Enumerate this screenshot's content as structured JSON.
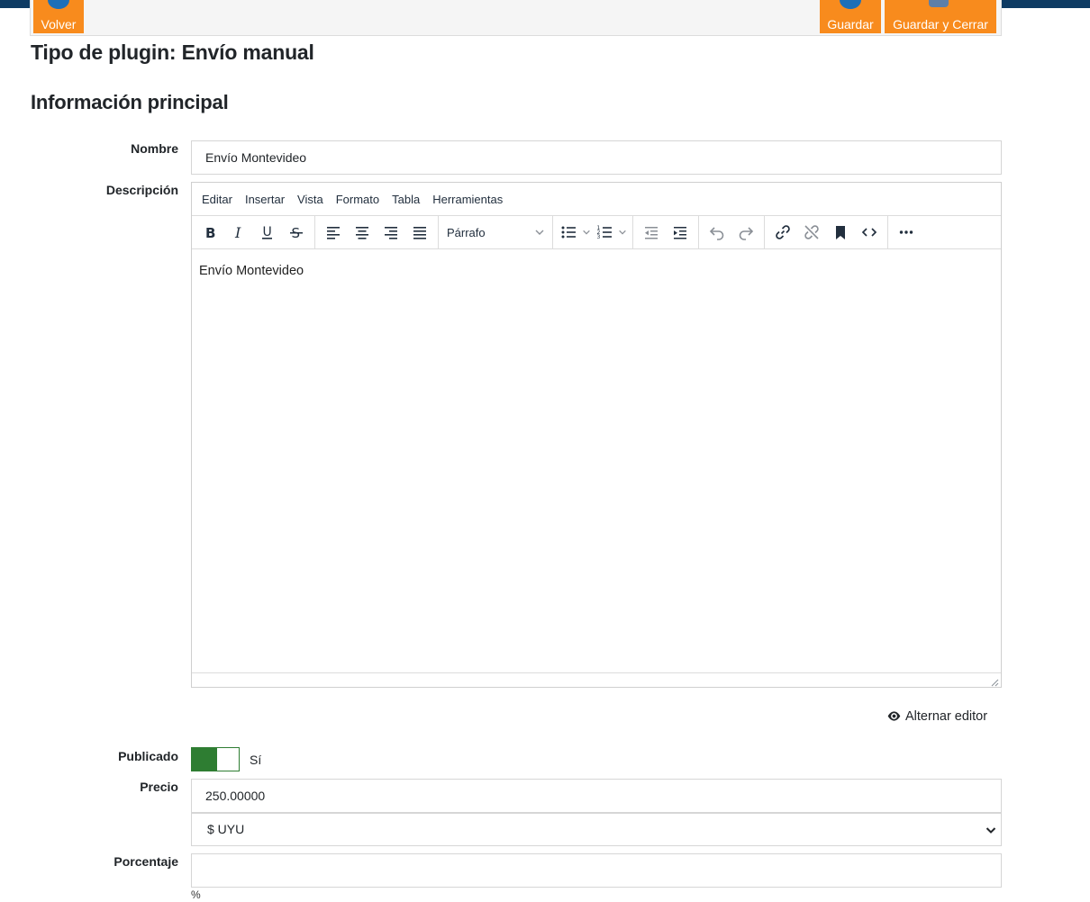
{
  "toolbar": {
    "back_label": "Volver",
    "save_label": "Guardar",
    "save_close_label": "Guardar y Cerrar"
  },
  "page": {
    "title": "Tipo de plugin: Envío manual",
    "section_title": "Información principal"
  },
  "fields": {
    "name_label": "Nombre",
    "name_value": "Envío Montevideo",
    "description_label": "Descripción",
    "published_label": "Publicado",
    "published_value": "Sí",
    "price_label": "Precio",
    "price_value": "250.00000",
    "currency_value": "$ UYU",
    "percentage_label": "Porcentaje",
    "percentage_value": "",
    "percentage_unit": "%"
  },
  "editor": {
    "menu": [
      "Editar",
      "Insertar",
      "Vista",
      "Formato",
      "Tabla",
      "Herramientas"
    ],
    "block_format": "Párrafo",
    "content": "Envío Montevideo",
    "toggle_label": "Alternar editor"
  },
  "colors": {
    "accent_orange": "#f88b1d",
    "top_bar": "#0e3b63",
    "switch_green": "#2e7d32"
  }
}
